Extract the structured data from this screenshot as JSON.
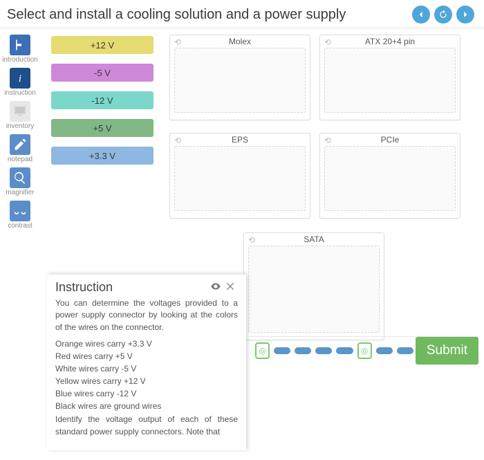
{
  "page_title": "Select and install a cooling solution and a power supply",
  "sidebar": {
    "items": [
      {
        "label": "introduction"
      },
      {
        "label": "instruction"
      },
      {
        "label": "inventory"
      },
      {
        "label": "notepad"
      },
      {
        "label": "magnifier"
      },
      {
        "label": "contrast"
      }
    ]
  },
  "voltages": {
    "items": [
      {
        "label": "+12 V",
        "color": "#e5db70"
      },
      {
        "label": "-5 V",
        "color": "#cd88d7"
      },
      {
        "label": "-12 V",
        "color": "#7cd7cb"
      },
      {
        "label": "+5 V",
        "color": "#82b786"
      },
      {
        "label": "+3.3 V",
        "color": "#8eb7e2"
      }
    ]
  },
  "targets": {
    "molex": "Molex",
    "atx": "ATX 20+4 pin",
    "eps": "EPS",
    "pcie": "PCIe",
    "sata": "SATA"
  },
  "instruction_panel": {
    "heading": "Instruction",
    "intro": "You can determine the voltages provided to a power supply connector by looking at the colors of the wires on the connector.",
    "lines": [
      "Orange wires carry +3.3 V",
      "Red wires carry +5 V",
      "White wires carry -5 V",
      "Yellow wires carry +12 V",
      "Blue wires carry -12 V",
      "Black wires are ground wires"
    ],
    "outro": "Identify the voltage output of each of these standard power supply connectors. Note that"
  },
  "submit_label": "Submit"
}
